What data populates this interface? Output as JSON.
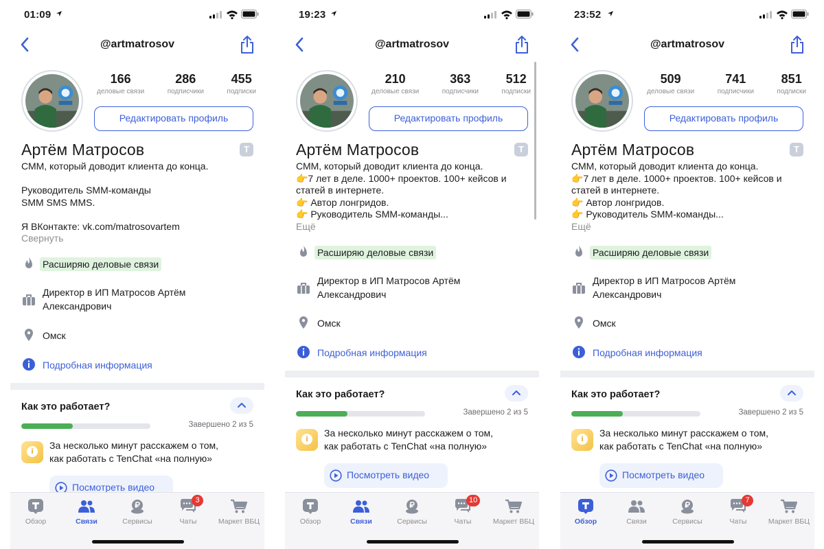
{
  "colors": {
    "accent": "#3c5fd8",
    "progress": "#4cae56",
    "tag_bg": "#dff3df",
    "badge": "#e53935"
  },
  "screens": [
    {
      "status": {
        "time": "01:09"
      },
      "nav": {
        "title": "@artmatrosov"
      },
      "stats": [
        {
          "value": "166",
          "label": "деловые связи"
        },
        {
          "value": "286",
          "label": "подписчики"
        },
        {
          "value": "455",
          "label": "подписки"
        }
      ],
      "edit_button": "Редактировать профиль",
      "badge_letter": "T",
      "name": "Артём Матросов",
      "bio": [
        "СММ, который доводит клиента до конца.",
        "",
        "Руководитель SMM-команды",
        "SMM SMS MMS.",
        "",
        "Я ВКонтакте: vk.com/matrosovartem"
      ],
      "bio_toggle": "Свернуть",
      "status_tag": "Расширяю деловые связи",
      "job": [
        "Директор в ИП Матросов Артём",
        "Александрович"
      ],
      "city": "Омск",
      "more_info": "Подробная информация",
      "how": {
        "title": "Как это работает?",
        "progress": 0.4,
        "done_text": "Завершено 2 из 5",
        "tip": [
          "За несколько минут расскажем о том,",
          "как работать с TenChat «на полную»"
        ],
        "video": "Посмотреть видео"
      },
      "tabs": [
        {
          "label": "Обзор",
          "icon": "tenchat-logo-icon"
        },
        {
          "label": "Связи",
          "icon": "people-icon",
          "active": true
        },
        {
          "label": "Сервисы",
          "icon": "ruble-coin-icon"
        },
        {
          "label": "Чаты",
          "icon": "chat-bubbles-icon",
          "badge": "3"
        },
        {
          "label": "Маркет ВБЦ",
          "icon": "cart-icon"
        }
      ]
    },
    {
      "status": {
        "time": "19:23"
      },
      "nav": {
        "title": "@artmatrosov"
      },
      "stats": [
        {
          "value": "210",
          "label": "деловые связи"
        },
        {
          "value": "363",
          "label": "подписчики"
        },
        {
          "value": "512",
          "label": "подписки"
        }
      ],
      "edit_button": "Редактировать профиль",
      "badge_letter": "T",
      "name": "Артём Матросов",
      "bio": [
        "СММ, который доводит клиента до конца.",
        "👉7 лет в деле. 1000+ проектов. 100+ кейсов и",
        "статей в интернете.",
        "👉 Автор лонгридов.",
        "👉 Руководитель SMM-команды..."
      ],
      "bio_toggle": "Ещё",
      "status_tag": "Расширяю деловые связи",
      "job": [
        "Директор в ИП Матросов Артём",
        "Александрович"
      ],
      "city": "Омск",
      "more_info": "Подробная информация",
      "how": {
        "title": "Как это работает?",
        "progress": 0.4,
        "done_text": "Завершено 2 из 5",
        "tip": [
          "За несколько минут расскажем о том,",
          "как работать с TenChat «на полную»"
        ],
        "video": "Посмотреть видео"
      },
      "tabs": [
        {
          "label": "Обзор",
          "icon": "tenchat-logo-icon"
        },
        {
          "label": "Связи",
          "icon": "people-icon",
          "active": true
        },
        {
          "label": "Сервисы",
          "icon": "ruble-coin-icon"
        },
        {
          "label": "Чаты",
          "icon": "chat-bubbles-icon",
          "badge": "10"
        },
        {
          "label": "Маркет ВБЦ",
          "icon": "cart-icon"
        }
      ]
    },
    {
      "status": {
        "time": "23:52"
      },
      "nav": {
        "title": "@artmatrosov"
      },
      "stats": [
        {
          "value": "509",
          "label": "деловые связи"
        },
        {
          "value": "741",
          "label": "подписчики"
        },
        {
          "value": "851",
          "label": "подписки"
        }
      ],
      "edit_button": "Редактировать профиль",
      "badge_letter": "T",
      "name": "Артём Матросов",
      "bio": [
        "СММ, который доводит клиента до конца.",
        "👉7 лет в деле. 1000+ проектов. 100+ кейсов и",
        "статей в интернете.",
        "👉 Автор лонгридов.",
        "👉 Руководитель SMM-команды..."
      ],
      "bio_toggle": "Ещё",
      "status_tag": "Расширяю деловые связи",
      "job": [
        "Директор в ИП Матросов Артём",
        "Александрович"
      ],
      "city": "Омск",
      "more_info": "Подробная информация",
      "how": {
        "title": "Как это работает?",
        "progress": 0.4,
        "done_text": "Завершено 2 из 5",
        "tip": [
          "За несколько минут расскажем о том,",
          "как работать с TenChat «на полную»"
        ],
        "video": "Посмотреть видео"
      },
      "tabs": [
        {
          "label": "Обзор",
          "icon": "tenchat-logo-icon",
          "active": true
        },
        {
          "label": "Связи",
          "icon": "people-icon"
        },
        {
          "label": "Сервисы",
          "icon": "ruble-coin-icon"
        },
        {
          "label": "Чаты",
          "icon": "chat-bubbles-icon",
          "badge": "7"
        },
        {
          "label": "Маркет ВБЦ",
          "icon": "cart-icon"
        }
      ]
    }
  ]
}
